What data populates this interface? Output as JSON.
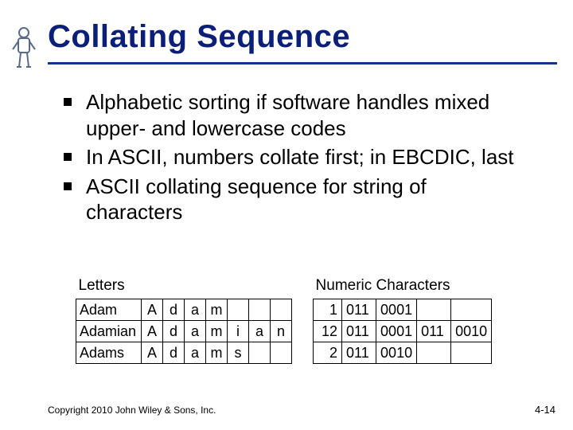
{
  "title": "Collating Sequence",
  "bullets": [
    "Alphabetic sorting if software handles mixed upper- and lowercase codes",
    "In ASCII, numbers collate first; in EBCDIC, last",
    "ASCII collating sequence for string of characters"
  ],
  "letters": {
    "header": "Letters",
    "rows": [
      {
        "label": "Adam",
        "chars": [
          "A",
          "d",
          "a",
          "m",
          "",
          "",
          ""
        ]
      },
      {
        "label": "Adamian",
        "chars": [
          "A",
          "d",
          "a",
          "m",
          "i",
          "a",
          "n"
        ]
      },
      {
        "label": "Adams",
        "chars": [
          "A",
          "d",
          "a",
          "m",
          "s",
          "",
          ""
        ]
      }
    ]
  },
  "numeric": {
    "header": "Numeric Characters",
    "rows": [
      {
        "n": "1",
        "groups": [
          "011",
          "0001",
          "",
          ""
        ]
      },
      {
        "n": "12",
        "groups": [
          "011",
          "0001",
          "011",
          "0010"
        ]
      },
      {
        "n": "2",
        "groups": [
          "011",
          "0010",
          "",
          ""
        ]
      }
    ]
  },
  "copyright": "Copyright 2010 John Wiley & Sons, Inc.",
  "pagenum": "4-14"
}
